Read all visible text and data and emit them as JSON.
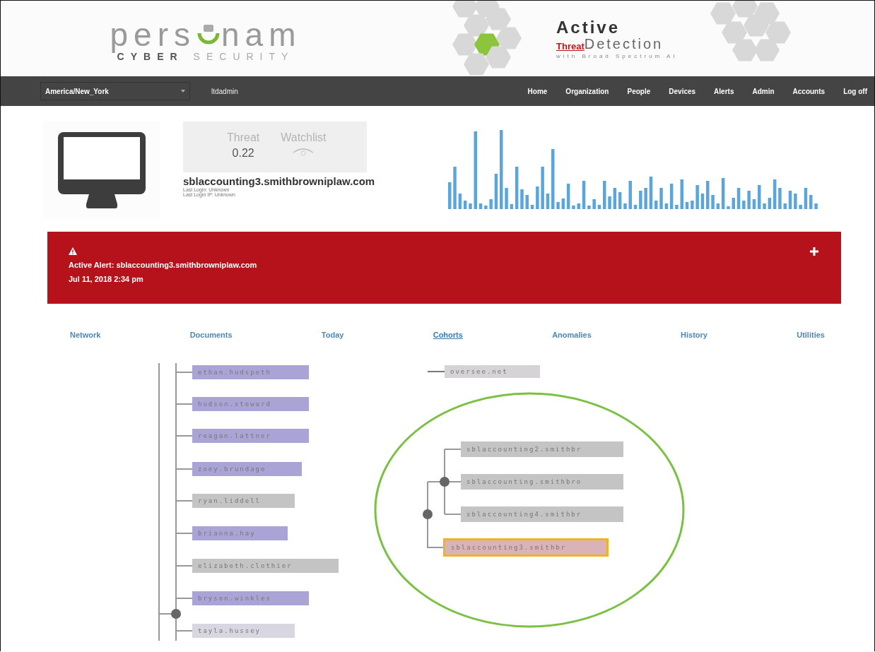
{
  "header": {
    "logo": {
      "word_start": "pers",
      "word_end": "nam",
      "tagline_strong": "CYBER",
      "tagline_light": "SECURITY"
    },
    "product": {
      "title": "Active",
      "highlight": "Threat",
      "subtitle": "Detection",
      "tagline": "with Broad Spectrum AI"
    }
  },
  "navbar": {
    "timezone": "America/New_York",
    "user": "ltdadmin",
    "links": [
      {
        "label": "Home"
      },
      {
        "label": "Organization"
      },
      {
        "label": "People"
      },
      {
        "label": "Devices"
      },
      {
        "label": "Alerts"
      },
      {
        "label": "Admin"
      },
      {
        "label": "Accounts"
      },
      {
        "label": "Log off"
      }
    ]
  },
  "device": {
    "threat_label": "Threat",
    "threat_value": "0.22",
    "watchlist_label": "Watchlist",
    "watched": false,
    "hostname": "sblaccounting3.smithbrowniplaw.com",
    "last_login": "Last Login: Unknown",
    "last_login_ip": "Last Login IP: Unknown"
  },
  "alert": {
    "message": "Active Alert: sblaccounting3.smithbrowniplaw.com",
    "time": "Jul 11, 2018 2:34 pm",
    "expanded": false
  },
  "tabs": [
    {
      "label": "Network",
      "selected": false
    },
    {
      "label": "Documents",
      "selected": false
    },
    {
      "label": "Today",
      "selected": false
    },
    {
      "label": "Cohorts",
      "selected": true
    },
    {
      "label": "Anomalies",
      "selected": false
    },
    {
      "label": "History",
      "selected": false
    },
    {
      "label": "Utilities",
      "selected": false
    }
  ],
  "cohort_tree": {
    "left_nodes": [
      {
        "label": "ethan.hudspeth",
        "color": "#a9a3d6",
        "selected": false
      },
      {
        "label": "hudson.steward",
        "color": "#a9a3d6",
        "selected": false
      },
      {
        "label": "reagan.lattner",
        "color": "#a9a3d6",
        "selected": false
      },
      {
        "label": "zoey.brundage",
        "color": "#a9a3d6",
        "selected": false
      },
      {
        "label": "ryan.liddell",
        "color": "#c4c4c4",
        "selected": false
      },
      {
        "label": "brianna.hay",
        "color": "#a9a3d6",
        "selected": false
      },
      {
        "label": "elizabeth.clothier",
        "color": "#c4c4c4",
        "selected": false
      },
      {
        "label": "bryson.winkles",
        "color": "#a9a3d6",
        "selected": false
      },
      {
        "label": "tayla.hussey",
        "color": "#d8d6e0",
        "selected": false
      }
    ],
    "top_right_node": {
      "label": "oversee.net",
      "color": "#d6d3d6",
      "selected": false
    },
    "circled_group": {
      "children": [
        {
          "children": [
            {
              "label": "sblaccounting2.smithbr",
              "color": "#c4c4c4",
              "selected": false
            },
            {
              "label": "sblaccounting.smithbro",
              "color": "#c4c4c4",
              "selected": false
            },
            {
              "label": "sblaccounting4.smithbr",
              "color": "#c4c4c4",
              "selected": false
            }
          ]
        },
        {
          "label": "sblaccounting3.smithbr",
          "color": "#d9b3b8",
          "selected": true
        }
      ]
    }
  }
}
